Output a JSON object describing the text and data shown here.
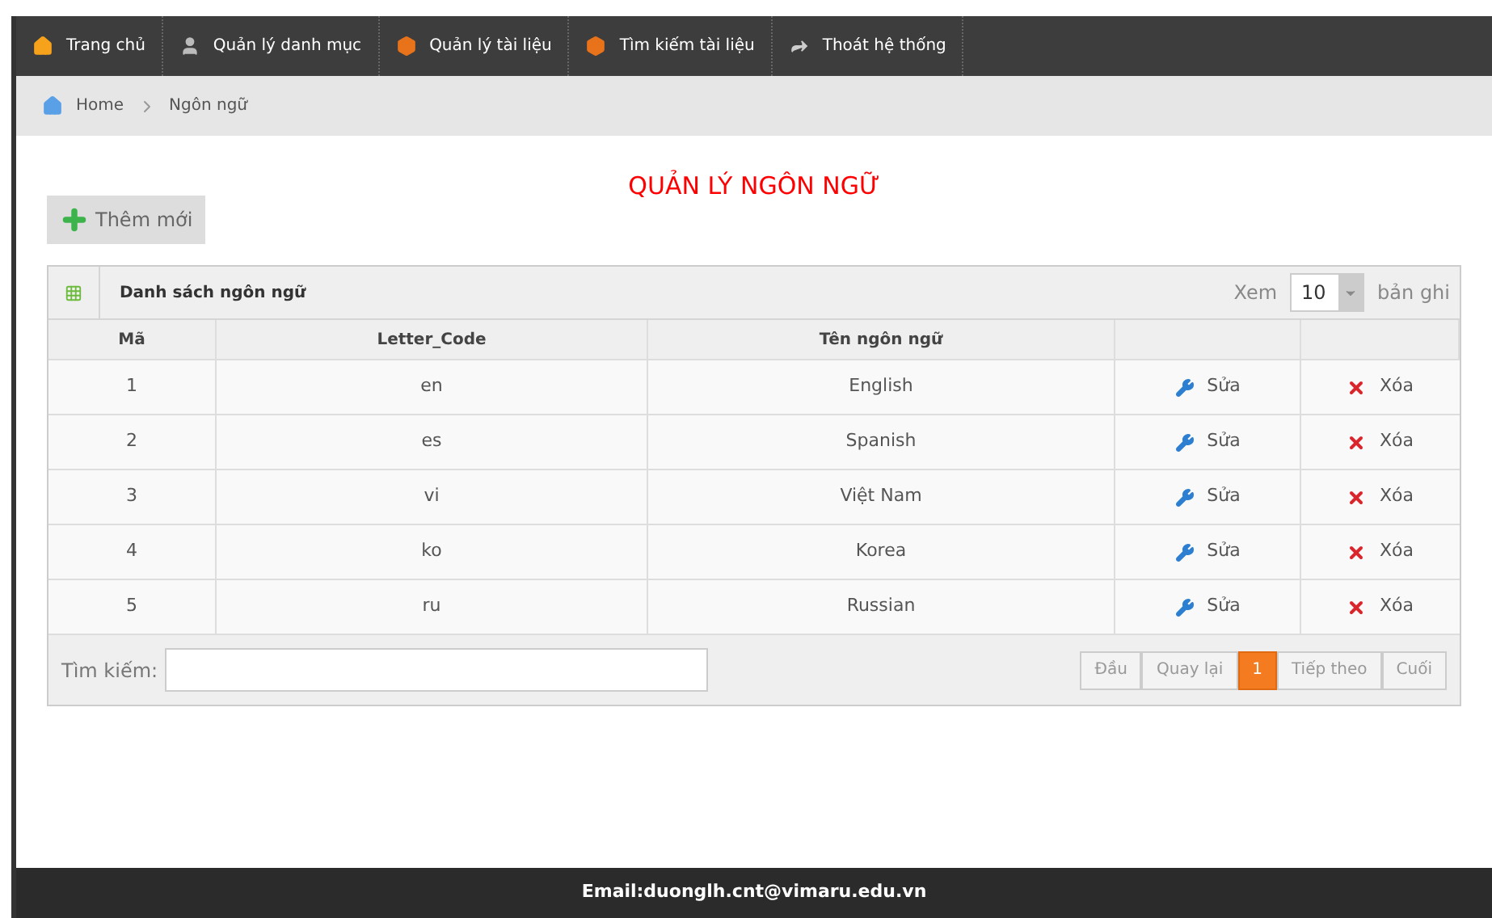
{
  "nav": [
    {
      "label": "Trang chủ",
      "kind": "home"
    },
    {
      "label": "Quản lý danh mục",
      "kind": "user"
    },
    {
      "label": "Quản lý tài liệu",
      "kind": "box"
    },
    {
      "label": "Tìm kiếm tài liệu",
      "kind": "box"
    },
    {
      "label": "Thoát hệ thống",
      "kind": "arrow"
    }
  ],
  "breadcrumb": [
    "Home",
    "Ngôn ngữ"
  ],
  "page_title": "QUẢN LÝ NGÔN NGỮ",
  "add_button": "Thêm mới",
  "panel": {
    "title": "Danh sách ngôn ngữ",
    "show_label": "Xem",
    "page_size": "10",
    "records_label": "bản ghi"
  },
  "table": {
    "columns": [
      "Mã",
      "Letter_Code",
      "Tên ngôn ngữ"
    ],
    "rows": [
      {
        "id": "1",
        "code": "en",
        "name": "English",
        "edit": "Sửa",
        "delete": "Xóa"
      },
      {
        "id": "2",
        "code": "es",
        "name": "Spanish",
        "edit": "Sửa",
        "delete": "Xóa"
      },
      {
        "id": "3",
        "code": "vi",
        "name": "Việt Nam",
        "edit": "Sửa",
        "delete": "Xóa"
      },
      {
        "id": "4",
        "code": "ko",
        "name": "Korea",
        "edit": "Sửa",
        "delete": "Xóa"
      },
      {
        "id": "5",
        "code": "ru",
        "name": "Russian",
        "edit": "Sửa",
        "delete": "Xóa"
      }
    ]
  },
  "search": {
    "label": "Tìm kiếm:"
  },
  "pagination": [
    {
      "label": "Đầu",
      "selected": false
    },
    {
      "label": "Quay lại",
      "selected": false
    },
    {
      "label": "1",
      "selected": true
    },
    {
      "label": "Tiếp theo",
      "selected": false
    },
    {
      "label": "Cuối",
      "selected": false
    }
  ],
  "footer": "Email:duonglh.cnt@vimaru.edu.vn"
}
